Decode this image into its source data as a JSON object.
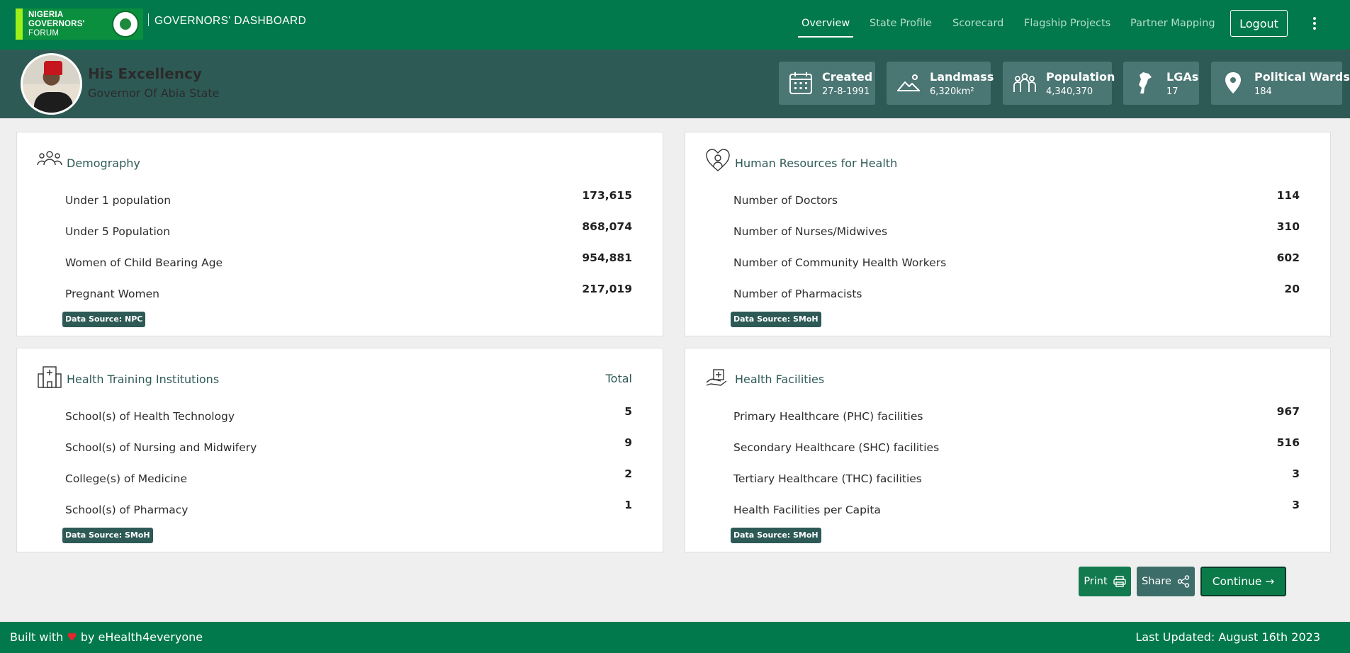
{
  "header": {
    "logo_lines": [
      "NIGERIA",
      "GOVERNORS'",
      "FORUM"
    ],
    "dashboard_title": "GOVERNORS' DASHBOARD",
    "nav": [
      {
        "label": "Overview",
        "active": true
      },
      {
        "label": "State Profile",
        "active": false
      },
      {
        "label": "Scorecard",
        "active": false
      },
      {
        "label": "Flagship Projects",
        "active": false
      },
      {
        "label": "Partner Mapping",
        "active": false
      }
    ],
    "logout_label": "Logout"
  },
  "governor": {
    "title": "His Excellency",
    "subtitle": "Governor Of Abia State"
  },
  "stats": [
    {
      "label": "Created",
      "value": "27-8-1991",
      "icon": "calendar-icon"
    },
    {
      "label": "Landmass",
      "value": "6,320km²",
      "icon": "landmass-icon"
    },
    {
      "label": "Population",
      "value": "4,340,370",
      "icon": "population-icon"
    },
    {
      "label": "LGAs",
      "value": "17",
      "icon": "state-map-icon"
    },
    {
      "label": "Political Wards",
      "value": "184",
      "icon": "location-pin-icon"
    }
  ],
  "cards": {
    "demography": {
      "title": "Demography",
      "rows": [
        {
          "label": "Under 1 population",
          "value": "173,615"
        },
        {
          "label": "Under 5 Population",
          "value": "868,074"
        },
        {
          "label": "Women of Child Bearing Age",
          "value": "954,881"
        },
        {
          "label": "Pregnant Women",
          "value": "217,019"
        }
      ],
      "source": "Data Source: NPC"
    },
    "hr": {
      "title": "Human Resources for Health",
      "rows": [
        {
          "label": "Number of Doctors",
          "value": "114"
        },
        {
          "label": "Number of Nurses/Midwives",
          "value": "310"
        },
        {
          "label": "Number of Community Health Workers",
          "value": "602"
        },
        {
          "label": "Number of Pharmacists",
          "value": "20"
        }
      ],
      "source": "Data Source: SMoH"
    },
    "training": {
      "title": "Health Training Institutions",
      "total_label": "Total",
      "rows": [
        {
          "label": "School(s) of Health Technology",
          "value": "5"
        },
        {
          "label": "School(s) of Nursing and Midwifery",
          "value": "9"
        },
        {
          "label": "College(s) of Medicine",
          "value": "2"
        },
        {
          "label": "School(s) of Pharmacy",
          "value": "1"
        }
      ],
      "source": "Data Source: SMoH"
    },
    "facilities": {
      "title": "Health Facilities",
      "rows": [
        {
          "label": "Primary Healthcare (PHC) facilities",
          "value": "967"
        },
        {
          "label": "Secondary Healthcare (SHC) facilities",
          "value": "516"
        },
        {
          "label": "Tertiary Healthcare (THC) facilities",
          "value": "3"
        },
        {
          "label": "Health Facilities per Capita",
          "value": "3"
        }
      ],
      "source": "Data Source: SMoH"
    }
  },
  "actions": {
    "print_label": "Print",
    "share_label": "Share",
    "continue_label": "Continue →"
  },
  "footer": {
    "built_prefix": "Built with",
    "heart": "♥",
    "built_suffix": "by eHealth4everyone",
    "last_updated": "Last Updated: August 16th 2023"
  },
  "colors": {
    "brand_green": "#01794c",
    "banner_teal": "#2e5a56",
    "stat_tile": "#4a7673"
  }
}
